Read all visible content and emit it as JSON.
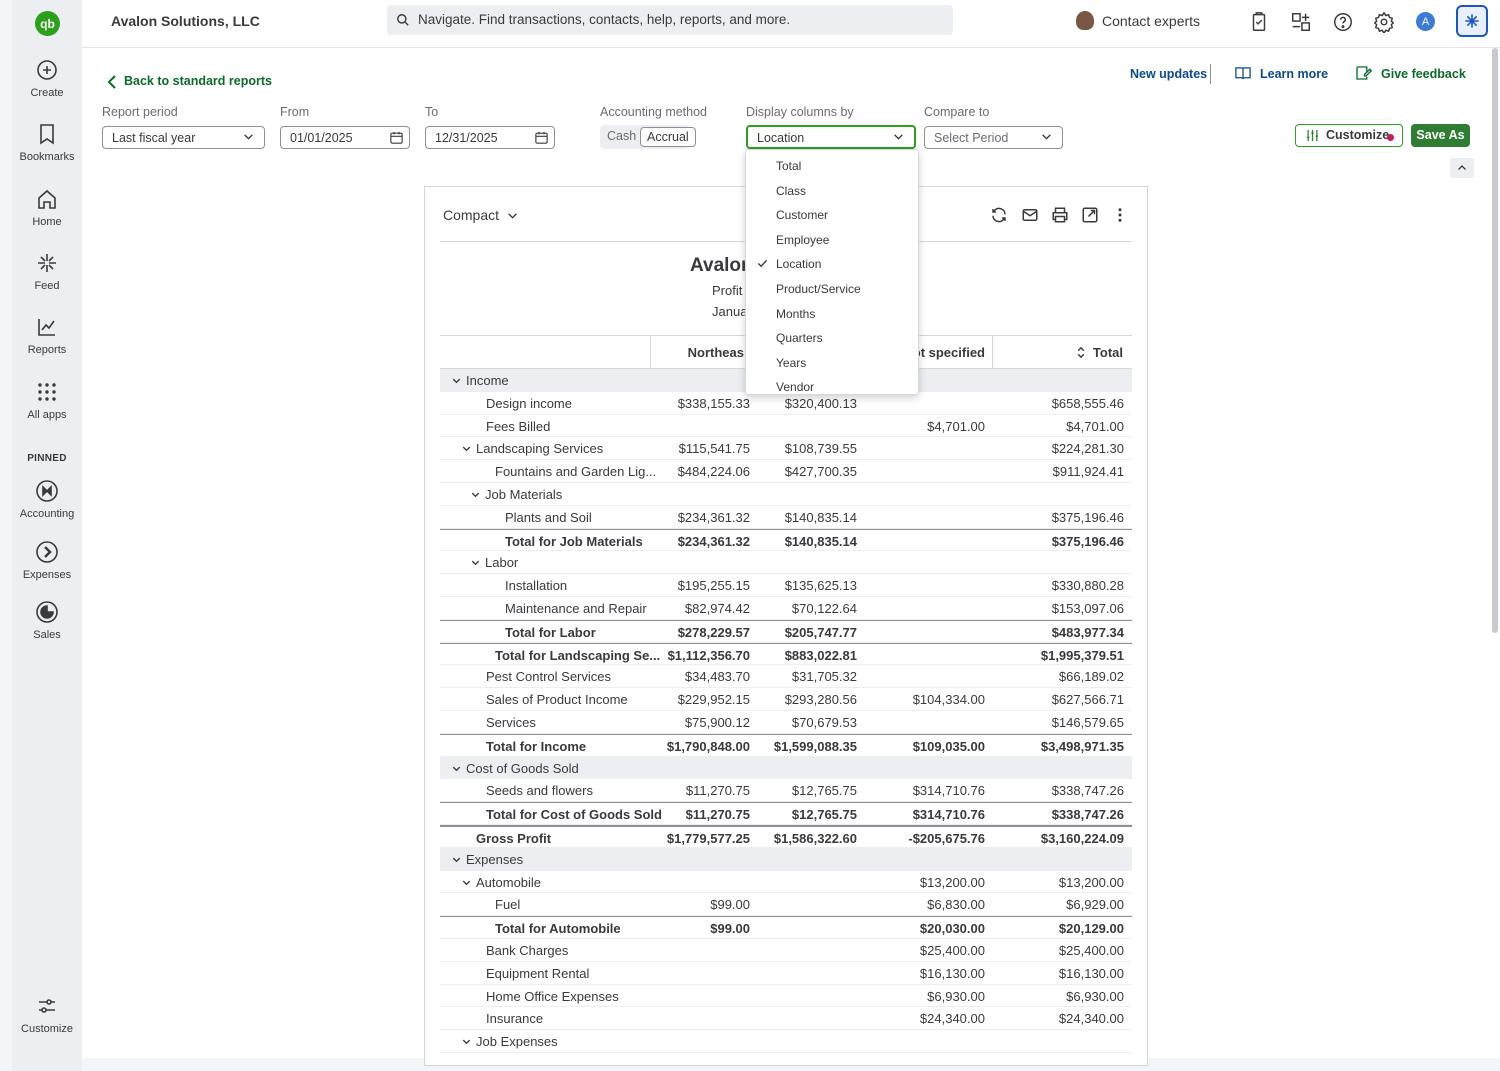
{
  "rail": {
    "logo": "qb",
    "items": [
      {
        "label": "Create"
      },
      {
        "label": "Bookmarks"
      },
      {
        "label": "Home"
      },
      {
        "label": "Feed"
      },
      {
        "label": "Reports"
      },
      {
        "label": "All apps"
      }
    ],
    "pinned_label": "PINNED",
    "pinned": [
      {
        "label": "Accounting"
      },
      {
        "label": "Expenses"
      },
      {
        "label": "Sales"
      }
    ],
    "customize": "Customize"
  },
  "topbar": {
    "company": "Avalon Solutions, LLC",
    "search_placeholder": "Navigate. Find transactions, contacts, help, reports, and more.",
    "contact_experts": "Contact experts",
    "avatar_letter": "A"
  },
  "header": {
    "back": "Back to standard reports",
    "new_updates": "New updates",
    "learn_more": "Learn more",
    "give_feedback": "Give feedback"
  },
  "filters": {
    "report_period_label": "Report period",
    "report_period": "Last fiscal year",
    "from_label": "From",
    "from": "01/01/2025",
    "to_label": "To",
    "to": "12/31/2025",
    "accounting_method_label": "Accounting method",
    "cash": "Cash",
    "accrual": "Accrual",
    "display_columns_label": "Display columns by",
    "display_columns": "Location",
    "compare_label": "Compare to",
    "compare": "Select Period",
    "customize": "Customize",
    "save_as": "Save As"
  },
  "dropdown": {
    "options": [
      "Total",
      "Class",
      "Customer",
      "Employee",
      "Location",
      "Product/Service",
      "Months",
      "Quarters",
      "Years",
      "Vendor"
    ],
    "selected": "Location"
  },
  "report": {
    "view": "Compact",
    "title": "Avalor",
    "subtitle": "Profit",
    "period": "Janua",
    "columns": [
      "Northeas",
      "ot specified",
      "Total"
    ],
    "rows": [
      {
        "label": "Income",
        "indent": 0,
        "toggle": true,
        "shade": true,
        "v": [
          "",
          "",
          "",
          ""
        ]
      },
      {
        "label": "Design income",
        "indent": 1,
        "v": [
          "$338,155.33",
          "$320,400.13",
          "",
          "$658,555.46"
        ]
      },
      {
        "label": "Fees Billed",
        "indent": 1,
        "v": [
          "",
          "",
          "$4,701.00",
          "$4,701.00"
        ]
      },
      {
        "label": "Landscaping Services",
        "indent": 1,
        "toggle": true,
        "v": [
          "$115,541.75",
          "$108,739.55",
          "",
          "$224,281.30"
        ]
      },
      {
        "label": "Fountains and Garden Lig...",
        "indent": 2,
        "v": [
          "$484,224.06",
          "$427,700.35",
          "",
          "$911,924.41"
        ]
      },
      {
        "label": "Job Materials",
        "indent": 2,
        "toggle": true,
        "v": [
          "",
          "",
          "",
          ""
        ]
      },
      {
        "label": "Plants and Soil",
        "indent": 3,
        "v": [
          "$234,361.32",
          "$140,835.14",
          "",
          "$375,196.46"
        ]
      },
      {
        "label": "Total for Job Materials",
        "indent": 3,
        "total": true,
        "v": [
          "$234,361.32",
          "$140,835.14",
          "",
          "$375,196.46"
        ]
      },
      {
        "label": "Labor",
        "indent": 2,
        "toggle": true,
        "v": [
          "",
          "",
          "",
          ""
        ]
      },
      {
        "label": "Installation",
        "indent": 3,
        "v": [
          "$195,255.15",
          "$135,625.13",
          "",
          "$330,880.28"
        ]
      },
      {
        "label": "Maintenance and Repair",
        "indent": 3,
        "v": [
          "$82,974.42",
          "$70,122.64",
          "",
          "$153,097.06"
        ]
      },
      {
        "label": "Total for Labor",
        "indent": 3,
        "total": true,
        "v": [
          "$278,229.57",
          "$205,747.77",
          "",
          "$483,977.34"
        ]
      },
      {
        "label": "Total for Landscaping Se...",
        "indent": 2,
        "total": true,
        "v": [
          "$1,112,356.70",
          "$883,022.81",
          "",
          "$1,995,379.51"
        ]
      },
      {
        "label": "Pest Control Services",
        "indent": 1,
        "v": [
          "$34,483.70",
          "$31,705.32",
          "",
          "$66,189.02"
        ]
      },
      {
        "label": "Sales of Product Income",
        "indent": 1,
        "v": [
          "$229,952.15",
          "$293,280.56",
          "$104,334.00",
          "$627,566.71"
        ]
      },
      {
        "label": "Services",
        "indent": 1,
        "v": [
          "$75,900.12",
          "$70,679.53",
          "",
          "$146,579.65"
        ]
      },
      {
        "label": "Total for Income",
        "indent": 1,
        "total": true,
        "v": [
          "$1,790,848.00",
          "$1,599,088.35",
          "$109,035.00",
          "$3,498,971.35"
        ]
      },
      {
        "label": "Cost of Goods Sold",
        "indent": 0,
        "toggle": true,
        "shade": true,
        "v": [
          "",
          "",
          "",
          ""
        ]
      },
      {
        "label": "Seeds and flowers",
        "indent": 1,
        "v": [
          "$11,270.75",
          "$12,765.75",
          "$314,710.76",
          "$338,747.26"
        ]
      },
      {
        "label": "Total for Cost of Goods Sold",
        "indent": 1,
        "total": true,
        "v": [
          "$11,270.75",
          "$12,765.75",
          "$314,710.76",
          "$338,747.26"
        ]
      },
      {
        "label": "Gross Profit",
        "indent": 0,
        "total": true,
        "gross": true,
        "v": [
          "$1,779,577.25",
          "$1,586,322.60",
          "-$205,675.76",
          "$3,160,224.09"
        ]
      },
      {
        "label": "Expenses",
        "indent": 0,
        "toggle": true,
        "shade": true,
        "v": [
          "",
          "",
          "",
          ""
        ]
      },
      {
        "label": "Automobile",
        "indent": 1,
        "toggle": true,
        "v": [
          "",
          "",
          "$13,200.00",
          "$13,200.00"
        ]
      },
      {
        "label": "Fuel",
        "indent": 2,
        "v": [
          "$99.00",
          "",
          "$6,830.00",
          "$6,929.00"
        ]
      },
      {
        "label": "Total for Automobile",
        "indent": 2,
        "total": true,
        "v": [
          "$99.00",
          "",
          "$20,030.00",
          "$20,129.00"
        ]
      },
      {
        "label": "Bank Charges",
        "indent": 1,
        "v": [
          "",
          "",
          "$25,400.00",
          "$25,400.00"
        ]
      },
      {
        "label": "Equipment Rental",
        "indent": 1,
        "v": [
          "",
          "",
          "$16,130.00",
          "$16,130.00"
        ]
      },
      {
        "label": "Home Office Expenses",
        "indent": 1,
        "v": [
          "",
          "",
          "$6,930.00",
          "$6,930.00"
        ]
      },
      {
        "label": "Insurance",
        "indent": 1,
        "v": [
          "",
          "",
          "$24,340.00",
          "$24,340.00"
        ]
      },
      {
        "label": "Job Expenses",
        "indent": 1,
        "toggle": true,
        "v": [
          "",
          "",
          "",
          ""
        ]
      }
    ]
  },
  "colors": {
    "brand": "#2ca01c",
    "save": "#2e7d32",
    "link": "#0b4a8f",
    "back_link": "#0b6b2c"
  }
}
